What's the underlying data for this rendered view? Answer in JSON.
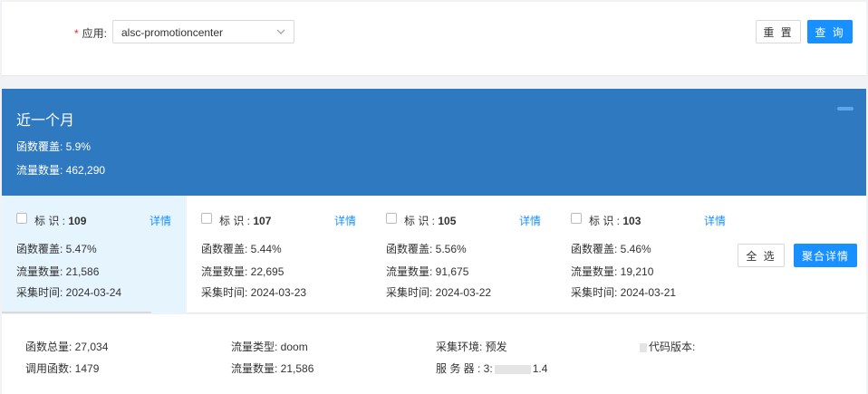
{
  "filter": {
    "required_mark": "*",
    "app_label": "应用:",
    "app_value": "alsc-promotioncenter",
    "reset_label": "重 置",
    "query_label": "查 询"
  },
  "month": {
    "title": "近一个月",
    "coverage": "函数覆盖: 5.9%",
    "traffic": "流量数量: 462,290"
  },
  "cards": [
    {
      "id_prefix": "标 识 : ",
      "id": "109",
      "detail": "详情",
      "coverage": "函数覆盖: 5.47%",
      "traffic": "流量数量: 21,586",
      "time": "采集时间: 2024-03-24"
    },
    {
      "id_prefix": "标 识 : ",
      "id": "107",
      "detail": "详情",
      "coverage": "函数覆盖: 5.44%",
      "traffic": "流量数量: 22,695",
      "time": "采集时间: 2024-03-23"
    },
    {
      "id_prefix": "标 识 : ",
      "id": "105",
      "detail": "详情",
      "coverage": "函数覆盖: 5.56%",
      "traffic": "流量数量: 91,675",
      "time": "采集时间: 2024-03-22"
    },
    {
      "id_prefix": "标 识 : ",
      "id": "103",
      "detail": "详情",
      "coverage": "函数覆盖: 5.46%",
      "traffic": "流量数量: 19,210",
      "time": "采集时间: 2024-03-21"
    }
  ],
  "actions": {
    "select_all": "全 选",
    "aggregate": "聚合详情"
  },
  "details": {
    "func_total": "函数总量: 27,034",
    "called_funcs": "调用函数: 1479",
    "traffic_type": "流量类型: doom",
    "traffic_count": "流量数量: 21,586",
    "env": "采集环境: 预发",
    "server_prefix": "服 务 器 : 3:",
    "server_suffix": "1.4",
    "code_version": "代码版本:"
  },
  "colors": {
    "primary": "#1890ff",
    "month_panel": "#2f79c0",
    "active_card": "#e6f4fe"
  }
}
